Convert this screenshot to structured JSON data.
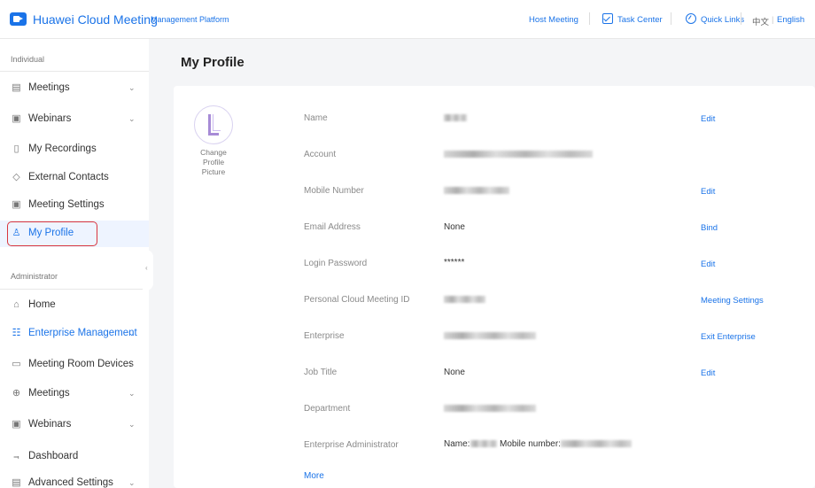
{
  "header": {
    "app_title": "Huawei Cloud Meeting",
    "app_subtitle": "Management Platform",
    "host_meeting": "Host Meeting",
    "task_center": "Task Center",
    "quick_links": "Quick Links",
    "lang_zh": "中文",
    "lang_sep": "|",
    "lang_en": "English",
    "brand_color": "#1a73e8"
  },
  "sidebar": {
    "individual_title": "Individual",
    "individual_items": [
      {
        "label": "Meetings",
        "icon": "calendar-icon",
        "expandable": true
      },
      {
        "label": "Webinars",
        "icon": "webinar-icon",
        "expandable": true
      },
      {
        "label": "My Recordings",
        "icon": "recording-icon",
        "expandable": false
      },
      {
        "label": "External Contacts",
        "icon": "contacts-icon",
        "expandable": false
      },
      {
        "label": "Meeting Settings",
        "icon": "settings-icon",
        "expandable": false
      },
      {
        "label": "My Profile",
        "icon": "user-icon",
        "expandable": false,
        "active": true
      }
    ],
    "admin_title": "Administrator",
    "admin_items": [
      {
        "label": "Home",
        "icon": "home-icon",
        "expandable": false
      },
      {
        "label": "Enterprise Management",
        "icon": "enterprise-icon",
        "expandable": true,
        "highlighted": true
      },
      {
        "label": "Meeting Room Devices",
        "icon": "device-icon",
        "expandable": true
      },
      {
        "label": "Meetings",
        "icon": "globe-icon",
        "expandable": true
      },
      {
        "label": "Webinars",
        "icon": "webinar-icon",
        "expandable": true
      },
      {
        "label": "Dashboard",
        "icon": "dashboard-icon",
        "expandable": false
      },
      {
        "label": "Advanced Settings",
        "icon": "advanced-settings-icon",
        "expandable": true
      }
    ]
  },
  "main": {
    "page_title": "My Profile",
    "avatar_label": "Change Profile Picture",
    "rows": [
      {
        "label": "Name",
        "value": "",
        "action": "Edit"
      },
      {
        "label": "Account",
        "value": "",
        "action": ""
      },
      {
        "label": "Mobile Number",
        "value": "",
        "action": "Edit"
      },
      {
        "label": "Email Address",
        "value": "None",
        "action": "Bind"
      },
      {
        "label": "Login Password",
        "value": "******",
        "action": "Edit"
      },
      {
        "label": "Personal Cloud Meeting ID",
        "value": "",
        "action": "Meeting Settings"
      },
      {
        "label": "Enterprise",
        "value": "",
        "action": "Exit Enterprise"
      },
      {
        "label": "Job Title",
        "value": "None",
        "action": "Edit"
      },
      {
        "label": "Department",
        "value": "",
        "action": ""
      },
      {
        "label": "Enterprise Administrator",
        "value": "",
        "action": ""
      }
    ],
    "admin_name_label": "Name:",
    "admin_mobile_label": "Mobile number:",
    "more_link": "More"
  }
}
